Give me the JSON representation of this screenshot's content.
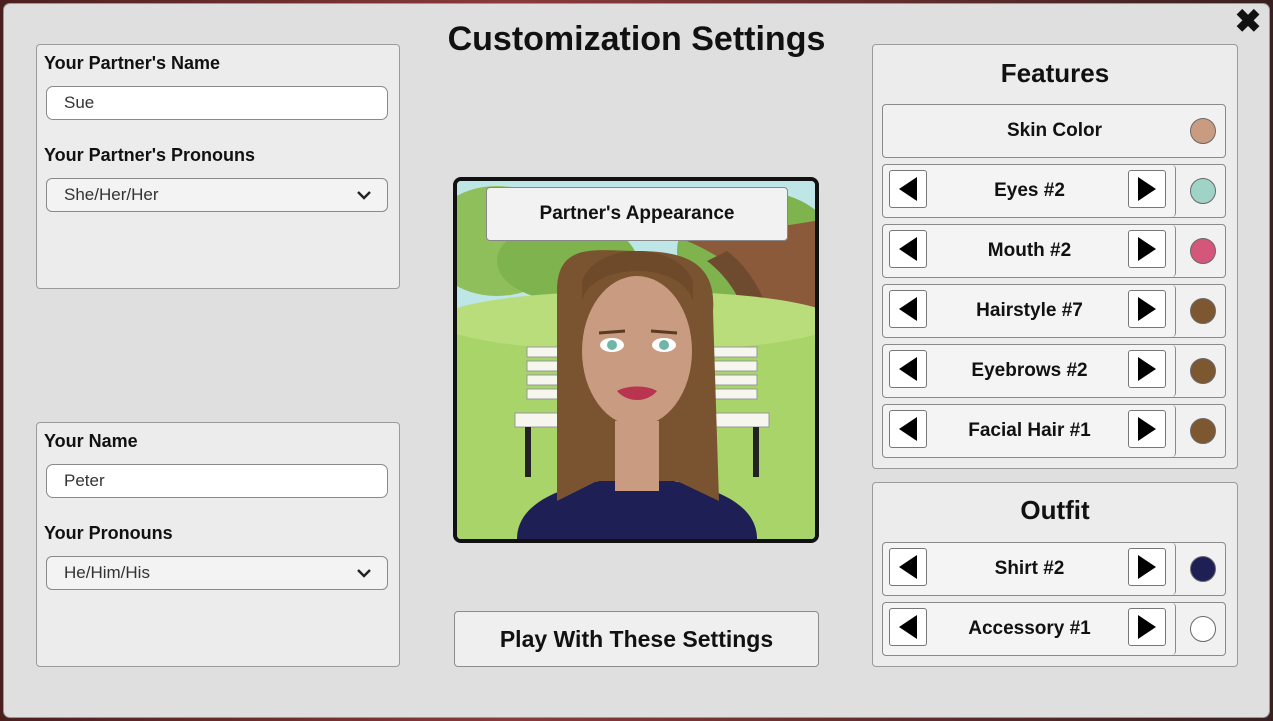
{
  "dialog": {
    "title": "Customization Settings"
  },
  "partner": {
    "name_label": "Your Partner's Name",
    "name_value": "Sue",
    "pronouns_label": "Your Partner's Pronouns",
    "pronouns_value": "She/Her/Her"
  },
  "user": {
    "name_label": "Your Name",
    "name_value": "Peter",
    "pronouns_label": "Your Pronouns",
    "pronouns_value": "He/Him/His"
  },
  "preview": {
    "label": "Partner's Appearance"
  },
  "play_button": "Play With These Settings",
  "features": {
    "title": "Features",
    "skin": {
      "label": "Skin Color",
      "color": "#c99b80"
    },
    "items": [
      {
        "label": "Eyes #2",
        "color": "#9fd3c5"
      },
      {
        "label": "Mouth #2",
        "color": "#d4567a"
      },
      {
        "label": "Hairstyle #7",
        "color": "#7d5730"
      },
      {
        "label": "Eyebrows #2",
        "color": "#7d5730"
      },
      {
        "label": "Facial Hair #1",
        "color": "#7d5730"
      }
    ]
  },
  "outfit": {
    "title": "Outfit",
    "items": [
      {
        "label": "Shirt #2",
        "color": "#1e1f55"
      },
      {
        "label": "Accessory #1",
        "color": "#ffffff"
      }
    ]
  },
  "icons": {
    "close": "close-icon",
    "arrow_left": "arrow-left-icon",
    "arrow_right": "arrow-right-icon",
    "chevron": "chevron-down-icon"
  }
}
